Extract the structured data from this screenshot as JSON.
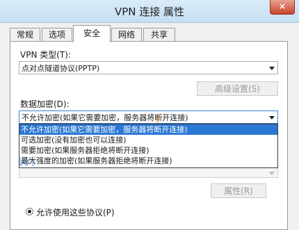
{
  "window": {
    "title": "VPN 连接 属性",
    "close_label": "×"
  },
  "tabs": [
    {
      "label": "常规"
    },
    {
      "label": "选项"
    },
    {
      "label": "安全"
    },
    {
      "label": "网络"
    },
    {
      "label": "共享"
    }
  ],
  "active_tab": "安全",
  "vpn_type": {
    "label": "VPN 类型(T):",
    "value": "点对点隧道协议(PPTP)"
  },
  "advanced_button": "高级设置(S)",
  "encryption": {
    "label": "数据加密(D):",
    "value": "不允许加密(如果它需要加密，服务器将断开连接)",
    "options": [
      "不允许加密(如果它需要加密，服务器将断开连接)",
      "可选加密(没有加密也可以连接)",
      "需要加密(如果服务器拒绝将断开连接)",
      "最大强度的加密(如果服务器拒绝将断开连接)"
    ],
    "selected_index": 0
  },
  "properties_button": "属性(R)",
  "allow_protocols": {
    "label": "允许使用这些协议(P)",
    "checked": true
  },
  "colors": {
    "selection": "#2a78d4",
    "titlebar": "#c5dff2",
    "close": "#c7432b"
  }
}
